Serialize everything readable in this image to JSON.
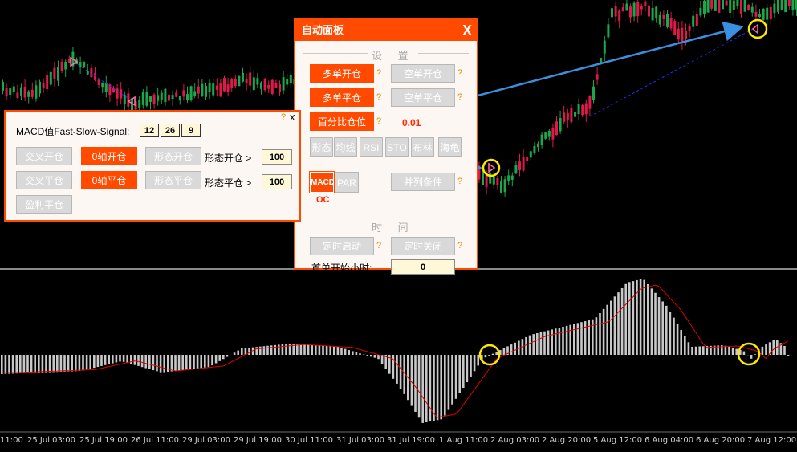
{
  "colors": {
    "accent": "#ff4a00",
    "bull": "#19a84a",
    "bear": "#e0194a",
    "hist": "#c8c8c8",
    "signal": "#e00000",
    "arrow": "#3a8fe0",
    "highlight": "#ffe800"
  },
  "auto_panel": {
    "title": "自动面板",
    "close": "X",
    "settings_title": "设 置",
    "long_open": "多单开仓",
    "short_open": "空单开仓",
    "long_close": "多单平仓",
    "short_close": "空单平仓",
    "percent_pos": "百分比仓位",
    "percent_value": "0.01",
    "indicators": [
      "形态",
      "均线",
      "RSI",
      "STO",
      "布林",
      "海龟"
    ],
    "macd_label": "MACD",
    "par_label": "PAR",
    "parallel_conditions": "并列条件",
    "oc_label": "OC",
    "time_title": "时 间",
    "timer_start": "定时启动",
    "timer_stop": "定时关闭",
    "first_open_hours": "首单开始小时:",
    "first_open_hours_value": "0",
    "question": "?"
  },
  "macd_panel": {
    "question": "?",
    "close": "x",
    "title": "MACD值Fast-Slow-Signal:",
    "fast": "12",
    "slow": "26",
    "signal": "9",
    "cross_open": "交叉开仓",
    "zero_open": "0轴开仓",
    "shape_open": "形态开仓",
    "cross_close": "交叉平仓",
    "zero_close": "0轴平仓",
    "shape_close": "形态平仓",
    "shape_open_label": "形态开仓 >",
    "shape_open_value": "100",
    "shape_close_label": "形态平仓 >",
    "shape_close_value": "100",
    "profit_close": "盈利平仓"
  },
  "x_axis": [
    "11:00",
    "25 Jul 03:00",
    "25 Jul 19:00",
    "26 Jul 11:00",
    "29 Jul 03:00",
    "29 Jul 19:00",
    "30 Jul 11:00",
    "31 Jul 03:00",
    "31 Jul 19:00",
    "1 Aug 11:00",
    "2 Aug 03:00",
    "2 Aug 20:00",
    "5 Aug 12:00",
    "6 Aug 04:00",
    "6 Aug 20:00",
    "7 Aug 12:00"
  ]
}
